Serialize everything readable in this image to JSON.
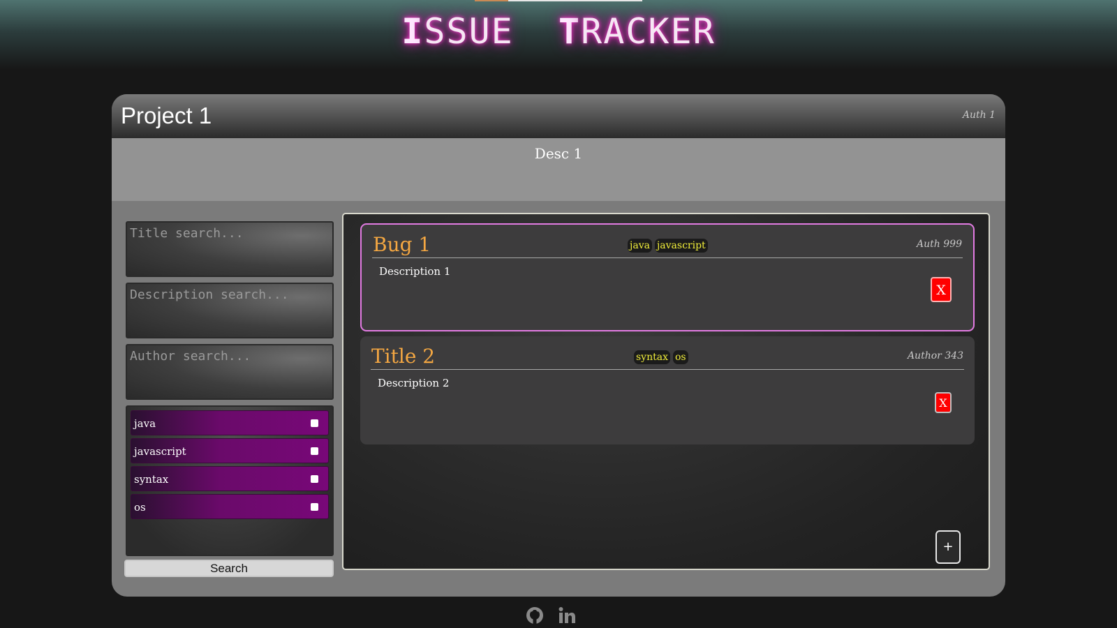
{
  "header": {
    "title_caps": [
      "I",
      "T"
    ],
    "title_rest": [
      "SSUE",
      "RACKER"
    ]
  },
  "project": {
    "title": "Project 1",
    "author": "Auth 1",
    "description": "Desc 1"
  },
  "search": {
    "title_placeholder": "Title search...",
    "description_placeholder": "Description search...",
    "author_placeholder": "Author search...",
    "tags": [
      "java",
      "javascript",
      "syntax",
      "os"
    ],
    "button_label": "Search"
  },
  "bugs": [
    {
      "title": "Bug 1",
      "tags": [
        "java",
        "javascript"
      ],
      "author": "Auth 999",
      "description": "Description 1",
      "delete_label": "X",
      "selected": true
    },
    {
      "title": "Title 2",
      "tags": [
        "syntax",
        "os"
      ],
      "author": "Author 343",
      "description": "Description 2",
      "delete_label": "X",
      "selected": false
    }
  ],
  "add_label": "+",
  "footer": {
    "icons": [
      "github-icon",
      "linkedin-icon"
    ]
  },
  "colors": {
    "accent_pink": "#e37be3",
    "bug_title": "#f4a742",
    "tag_text": "#f2ef3a",
    "delete_red": "#ff0000",
    "tag_row": "#780878"
  }
}
